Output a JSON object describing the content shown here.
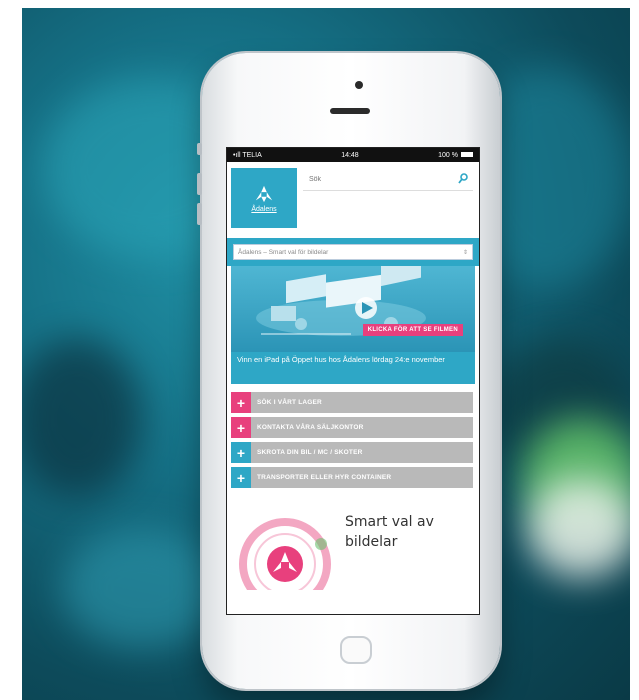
{
  "status_bar": {
    "carrier": "•ıll TELIA",
    "time": "14:48",
    "battery": "100 %"
  },
  "header": {
    "logo_text": "Ådalens",
    "search_placeholder": "Sök"
  },
  "select": {
    "value": "Ådalens – Smart val för bildelar"
  },
  "banner": {
    "video_button": "KLICKA FÖR ATT SE FILMEN",
    "caption": "Vinn en iPad på Öppet hus hos Ådalens lördag 24:e november"
  },
  "menu": [
    {
      "label": "SÖK I VÅRT LAGER",
      "accent": "pink"
    },
    {
      "label": "KONTAKTA VÅRA SÄLJKONTOR",
      "accent": "pink"
    },
    {
      "label": "SKROTA DIN BIL / MC / SKOTER",
      "accent": "blue"
    },
    {
      "label": "TRANSPORTER ELLER HYR CONTAINER",
      "accent": "blue"
    }
  ],
  "footer": {
    "slogan_line1": "Smart val av",
    "slogan_line2": "bildelar"
  },
  "colors": {
    "brand_blue": "#2ea7c6",
    "brand_pink": "#e8407d",
    "menu_gray": "#b9b9b9"
  }
}
